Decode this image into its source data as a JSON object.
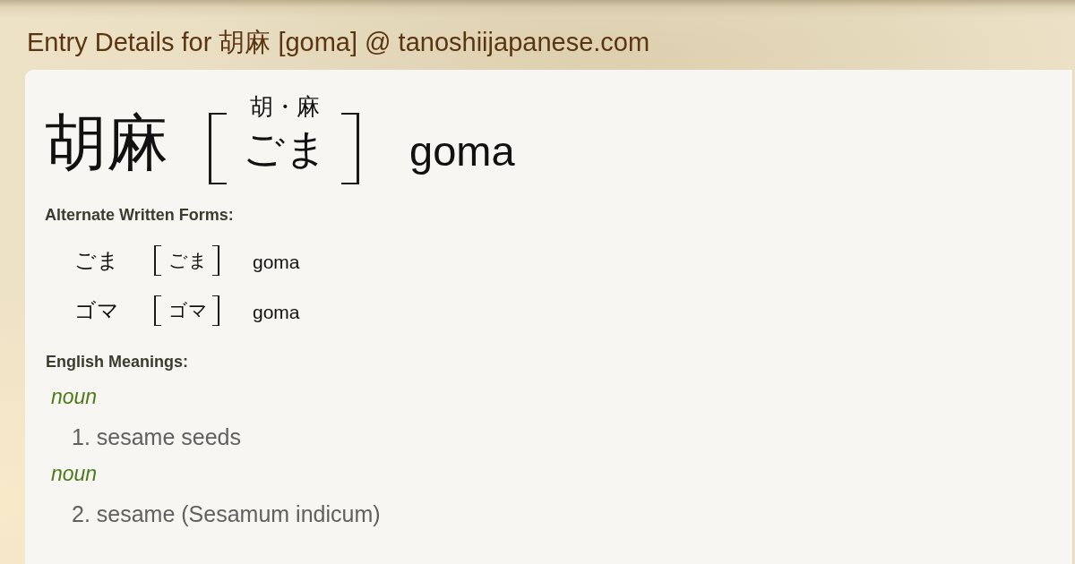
{
  "page_title": "Entry Details for 胡麻 [goma] @ tanoshiijapanese.com",
  "entry": {
    "word": "胡麻",
    "furigana": "胡・麻",
    "reading": "ごま",
    "romaji": "goma"
  },
  "alternate_forms": {
    "heading": "Alternate Written Forms:",
    "items": [
      {
        "form": "ごま",
        "reading": "ごま",
        "romaji": "goma"
      },
      {
        "form": "ゴマ",
        "reading": "ゴマ",
        "romaji": "goma"
      }
    ]
  },
  "meanings": {
    "heading": "English Meanings:",
    "senses": [
      {
        "part_of_speech": "noun",
        "gloss": "1. sesame seeds"
      },
      {
        "part_of_speech": "noun",
        "gloss": "2. sesame (Sesamum indicum)"
      }
    ]
  }
}
